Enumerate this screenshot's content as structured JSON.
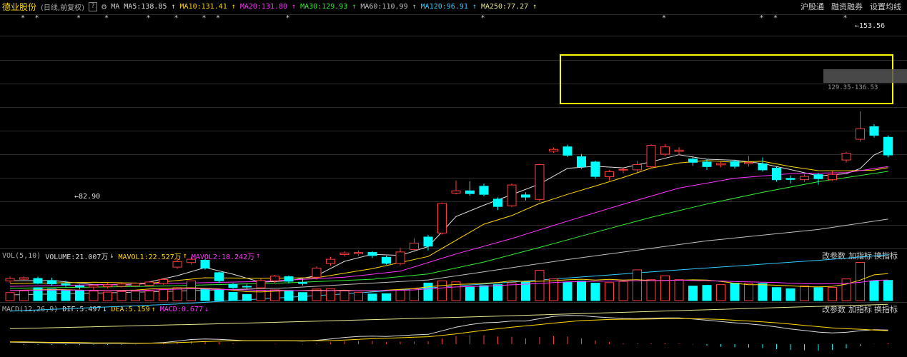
{
  "header": {
    "stock_name": "德业股份",
    "mode": "(日线,前复权)",
    "help": "?",
    "gear_icon": "gear-icon",
    "ma_label": "MA",
    "ma": [
      {
        "label": "MA5:138.85",
        "arrow": "↑",
        "color": "#dddddd"
      },
      {
        "label": "MA10:131.41",
        "arrow": "↑",
        "color": "#ffd700"
      },
      {
        "label": "MA20:131.80",
        "arrow": "↑",
        "color": "#ff33ff"
      },
      {
        "label": "MA30:129.93",
        "arrow": "↑",
        "color": "#33ee33"
      },
      {
        "label": "MA60:110.99",
        "arrow": "↑",
        "color": "#c0c0c0"
      },
      {
        "label": "MA120:96.91",
        "arrow": "↑",
        "color": "#33ccff"
      },
      {
        "label": "MA250:77.27",
        "arrow": "↑",
        "color": "#e8e890"
      }
    ],
    "right_buttons": [
      "沪股通",
      "融资融券",
      "设置均线"
    ]
  },
  "vol_header": {
    "label": "VOL(5,10)",
    "volume": "VOLUME:21.007万",
    "volume_arrow": "↓",
    "mavol1": "MAVOL1:22.527万",
    "mavol1_arrow": "↑",
    "mavol2": "MAVOL2:18.242万",
    "mavol2_arrow": "↑",
    "buttons": [
      "改参数",
      "加指标",
      "换指标"
    ]
  },
  "macd_header": {
    "label": "MACD(12,26,9)",
    "dif": "DIF:5.497",
    "dif_arrow": "↓",
    "dea": "DEA:5.159",
    "dea_arrow": "↑",
    "macd": "MACD:0.677",
    "macd_arrow": "↓",
    "buttons": [
      "改参数",
      "加指标",
      "换指标"
    ]
  },
  "annotations": {
    "high": "153.56",
    "low": "82.90",
    "range_label": "129.35-136.53"
  },
  "colors": {
    "up": "#ff3b3b",
    "down": "#00ffff",
    "box": "#ffff00"
  },
  "chart_data": {
    "type": "candlestick",
    "candles": [
      {
        "o": 86.5,
        "c": 87.5,
        "h": 88.3,
        "l": 85.8
      },
      {
        "o": 87.2,
        "c": 87.8,
        "h": 88.4,
        "l": 86.6
      },
      {
        "o": 87.5,
        "c": 85.6,
        "h": 88.2,
        "l": 85.2
      },
      {
        "o": 86.7,
        "c": 85.4,
        "h": 87.8,
        "l": 84.6
      },
      {
        "o": 85.4,
        "c": 84.9,
        "h": 86.6,
        "l": 84.2
      },
      {
        "o": 84.6,
        "c": 84.1,
        "h": 85.1,
        "l": 83.2
      },
      {
        "o": 84.1,
        "c": 84.8,
        "h": 85.4,
        "l": 83.0
      },
      {
        "o": 84.3,
        "c": 85.0,
        "h": 85.6,
        "l": 83.6
      },
      {
        "o": 84.4,
        "c": 85.3,
        "h": 85.7,
        "l": 83.9
      },
      {
        "o": 84.6,
        "c": 85.6,
        "h": 86.0,
        "l": 84.0
      },
      {
        "o": 84.8,
        "c": 86.1,
        "h": 86.5,
        "l": 84.5
      },
      {
        "o": 85.5,
        "c": 87.1,
        "h": 87.6,
        "l": 85.0
      },
      {
        "o": 92.0,
        "c": 94.2,
        "h": 95.6,
        "l": 91.3
      },
      {
        "o": 93.8,
        "c": 95.1,
        "h": 96.1,
        "l": 93.0
      },
      {
        "o": 94.7,
        "c": 91.6,
        "h": 95.2,
        "l": 91.0
      },
      {
        "o": 89.8,
        "c": 86.6,
        "h": 90.1,
        "l": 85.8
      },
      {
        "o": 85.2,
        "c": 83.9,
        "h": 85.7,
        "l": 83.4
      },
      {
        "o": 84.4,
        "c": 84.1,
        "h": 85.2,
        "l": 83.4
      },
      {
        "o": 83.8,
        "c": 86.7,
        "h": 87.5,
        "l": 83.2
      },
      {
        "o": 86.6,
        "c": 88.4,
        "h": 88.9,
        "l": 85.8
      },
      {
        "o": 88.2,
        "c": 86.4,
        "h": 88.7,
        "l": 85.5
      },
      {
        "o": 86.0,
        "c": 85.5,
        "h": 87.4,
        "l": 84.7
      },
      {
        "o": 88.0,
        "c": 91.6,
        "h": 92.3,
        "l": 87.0
      },
      {
        "o": 93.4,
        "c": 95.1,
        "h": 96.1,
        "l": 92.6
      },
      {
        "o": 97.0,
        "c": 97.6,
        "h": 98.2,
        "l": 96.2
      },
      {
        "o": 97.3,
        "c": 97.8,
        "h": 98.5,
        "l": 96.5
      },
      {
        "o": 97.8,
        "c": 96.6,
        "h": 98.3,
        "l": 95.6
      },
      {
        "o": 95.9,
        "c": 93.5,
        "h": 96.5,
        "l": 93.0
      },
      {
        "o": 93.4,
        "c": 98.0,
        "h": 99.6,
        "l": 92.7
      },
      {
        "o": 99.0,
        "c": 101.5,
        "h": 103.4,
        "l": 98.0
      },
      {
        "o": 103.9,
        "c": 100.3,
        "h": 104.8,
        "l": 98.6
      },
      {
        "o": 105.5,
        "c": 117.2,
        "h": 117.5,
        "l": 104.9
      },
      {
        "o": 121.3,
        "c": 122.2,
        "h": 126.3,
        "l": 120.8
      },
      {
        "o": 122.2,
        "c": 121.1,
        "h": 125.9,
        "l": 120.3
      },
      {
        "o": 124.0,
        "c": 120.8,
        "h": 125.1,
        "l": 120.0
      },
      {
        "o": 118.9,
        "c": 116.0,
        "h": 119.6,
        "l": 114.6
      },
      {
        "o": 116.3,
        "c": 124.5,
        "h": 125.1,
        "l": 115.7
      },
      {
        "o": 120.6,
        "c": 119.7,
        "h": 121.6,
        "l": 118.4
      },
      {
        "o": 118.8,
        "c": 132.6,
        "h": 132.9,
        "l": 118.0
      },
      {
        "o": 137.9,
        "c": 138.6,
        "h": 139.3,
        "l": 137.3
      },
      {
        "o": 139.6,
        "c": 136.3,
        "h": 140.5,
        "l": 135.6
      },
      {
        "o": 135.7,
        "c": 131.7,
        "h": 136.8,
        "l": 130.9
      },
      {
        "o": 133.6,
        "c": 127.9,
        "h": 134.1,
        "l": 127.0
      },
      {
        "o": 127.8,
        "c": 129.8,
        "h": 130.4,
        "l": 126.3
      },
      {
        "o": 130.4,
        "c": 130.7,
        "h": 131.2,
        "l": 129.2
      },
      {
        "o": 130.5,
        "c": 132.6,
        "h": 134.1,
        "l": 129.5
      },
      {
        "o": 131.7,
        "c": 140.2,
        "h": 140.6,
        "l": 131.2
      },
      {
        "o": 136.7,
        "c": 139.6,
        "h": 140.6,
        "l": 136.0
      },
      {
        "o": 137.8,
        "c": 138.3,
        "h": 139.5,
        "l": 136.3
      },
      {
        "o": 134.8,
        "c": 133.5,
        "h": 135.9,
        "l": 132.1
      },
      {
        "o": 133.6,
        "c": 131.8,
        "h": 134.8,
        "l": 130.5
      },
      {
        "o": 132.5,
        "c": 133.0,
        "h": 133.7,
        "l": 131.5
      },
      {
        "o": 133.8,
        "c": 131.9,
        "h": 134.5,
        "l": 131.0
      },
      {
        "o": 132.9,
        "c": 133.4,
        "h": 136.0,
        "l": 131.8
      },
      {
        "o": 132.9,
        "c": 130.5,
        "h": 135.4,
        "l": 129.8
      },
      {
        "o": 131.2,
        "c": 126.6,
        "h": 131.7,
        "l": 125.8
      },
      {
        "o": 127.1,
        "c": 126.7,
        "h": 128.3,
        "l": 125.1
      },
      {
        "o": 126.6,
        "c": 127.9,
        "h": 128.7,
        "l": 125.7
      },
      {
        "o": 128.6,
        "c": 127.0,
        "h": 129.3,
        "l": 124.6
      },
      {
        "o": 126.6,
        "c": 128.7,
        "h": 130.0,
        "l": 126.1
      },
      {
        "o": 134.4,
        "c": 137.1,
        "h": 137.6,
        "l": 133.4
      },
      {
        "o": 142.6,
        "c": 146.8,
        "h": 153.6,
        "l": 141.7
      },
      {
        "o": 147.6,
        "c": 144.2,
        "h": 148.6,
        "l": 143.3
      },
      {
        "o": 143.4,
        "c": 136.4,
        "h": 144.1,
        "l": 135.5
      }
    ],
    "ma_lines": [
      {
        "name": "MA5",
        "color": "#dddddd",
        "pts": [
          [
            0,
            86.6
          ],
          [
            3,
            86.7
          ],
          [
            6,
            85.1
          ],
          [
            9,
            84.9
          ],
          [
            12,
            88.6
          ],
          [
            14,
            91.8
          ],
          [
            16,
            89.2
          ],
          [
            18,
            86.0
          ],
          [
            20,
            86.6
          ],
          [
            22,
            88.6
          ],
          [
            24,
            94.3
          ],
          [
            26,
            97.1
          ],
          [
            28,
            96.6
          ],
          [
            30,
            100.1
          ],
          [
            31,
            106.0
          ],
          [
            32,
            112.0
          ],
          [
            34,
            116.5
          ],
          [
            36,
            120.7
          ],
          [
            38,
            124.9
          ],
          [
            40,
            131.1
          ],
          [
            42,
            131.9
          ],
          [
            44,
            131.3
          ],
          [
            46,
            133.7
          ],
          [
            48,
            136.5
          ],
          [
            50,
            134.7
          ],
          [
            52,
            134.3
          ],
          [
            54,
            133.0
          ],
          [
            56,
            130.6
          ],
          [
            58,
            128.1
          ],
          [
            60,
            129.0
          ],
          [
            61,
            131.0
          ],
          [
            62,
            136.4
          ],
          [
            63,
            138.9
          ]
        ]
      },
      {
        "name": "MA10",
        "color": "#ffd700",
        "pts": [
          [
            0,
            85.5
          ],
          [
            6,
            86.0
          ],
          [
            10,
            85.6
          ],
          [
            14,
            87.8
          ],
          [
            18,
            87.6
          ],
          [
            22,
            87.8
          ],
          [
            26,
            91.4
          ],
          [
            30,
            96.2
          ],
          [
            32,
            102.6
          ],
          [
            34,
            109.0
          ],
          [
            36,
            112.4
          ],
          [
            38,
            117.2
          ],
          [
            40,
            120.8
          ],
          [
            42,
            124.1
          ],
          [
            44,
            127.5
          ],
          [
            46,
            131.2
          ],
          [
            48,
            133.2
          ],
          [
            50,
            134.2
          ],
          [
            52,
            133.5
          ],
          [
            54,
            133.9
          ],
          [
            56,
            131.8
          ],
          [
            58,
            130.2
          ],
          [
            60,
            130.1
          ],
          [
            62,
            130.4
          ],
          [
            63,
            131.4
          ]
        ]
      },
      {
        "name": "MA20",
        "color": "#ff33ff",
        "pts": [
          [
            0,
            84.4
          ],
          [
            10,
            85.4
          ],
          [
            18,
            86.3
          ],
          [
            24,
            88.0
          ],
          [
            28,
            90.4
          ],
          [
            32,
            97.2
          ],
          [
            36,
            103.3
          ],
          [
            40,
            110.2
          ],
          [
            44,
            116.9
          ],
          [
            48,
            123.3
          ],
          [
            52,
            127.2
          ],
          [
            56,
            129.0
          ],
          [
            60,
            129.4
          ],
          [
            63,
            131.8
          ]
        ]
      },
      {
        "name": "MA30",
        "color": "#33ee33",
        "pts": [
          [
            0,
            83.6
          ],
          [
            10,
            84.4
          ],
          [
            20,
            85.8
          ],
          [
            26,
            87.2
          ],
          [
            30,
            89.3
          ],
          [
            34,
            94.0
          ],
          [
            38,
            99.8
          ],
          [
            42,
            105.8
          ],
          [
            46,
            111.7
          ],
          [
            50,
            117.0
          ],
          [
            54,
            121.6
          ],
          [
            58,
            125.8
          ],
          [
            63,
            129.9
          ]
        ]
      },
      {
        "name": "MA60",
        "color": "#c0c0c0",
        "pts": [
          [
            0,
            81.0
          ],
          [
            10,
            82.2
          ],
          [
            20,
            83.8
          ],
          [
            30,
            86.9
          ],
          [
            40,
            95.0
          ],
          [
            50,
            102.4
          ],
          [
            58,
            106.9
          ],
          [
            63,
            110.99
          ]
        ]
      },
      {
        "name": "MA120",
        "color": "#33ccff",
        "pts": [
          [
            0,
            74.6
          ],
          [
            12,
            77.4
          ],
          [
            24,
            81.4
          ],
          [
            36,
            86.1
          ],
          [
            48,
            90.9
          ],
          [
            58,
            94.7
          ],
          [
            63,
            96.91
          ]
        ]
      },
      {
        "name": "MA250",
        "color": "#e8e890",
        "pts": [
          [
            0,
            67.6
          ],
          [
            16,
            69.7
          ],
          [
            32,
            72.1
          ],
          [
            48,
            74.8
          ],
          [
            63,
            77.27
          ]
        ]
      }
    ],
    "volume": [
      5.5,
      6.7,
      8.8,
      7.9,
      7.3,
      6.9,
      6.5,
      5.8,
      6.2,
      6.4,
      6.5,
      7.6,
      8.8,
      13.5,
      8.2,
      7.2,
      5.6,
      4.2,
      6.9,
      7.3,
      6.9,
      5.5,
      7.9,
      8.0,
      6.7,
      5.7,
      4.5,
      4.7,
      7.1,
      8.0,
      12.0,
      13.5,
      12.8,
      9.2,
      10.2,
      10.9,
      12.2,
      12.6,
      20.7,
      14.8,
      12.4,
      13.3,
      11.9,
      12.3,
      13.1,
      21.0,
      14.3,
      17.0,
      14.3,
      9.9,
      10.4,
      10.9,
      11.9,
      11.8,
      11.7,
      8.9,
      8.1,
      10.0,
      8.9,
      9.0,
      14.8,
      26.1,
      13.5,
      13.8
    ],
    "mavol1": [
      6.8,
      7.1,
      7.3,
      7.6,
      7.4,
      7.1,
      7.0,
      6.9,
      7.0,
      7.2,
      7.9,
      8.3,
      8.6,
      8.8,
      8.4,
      8.0,
      7.1,
      6.1,
      5.9,
      6.4,
      6.8,
      6.9,
      7.1,
      6.9,
      7.1,
      6.8,
      6.5,
      7.1,
      7.7,
      8.3,
      9.4,
      10.3,
      11.0,
      11.3,
      11.8,
      12.4,
      13.5,
      13.0,
      13.2,
      13.6,
      14.2,
      14.6,
      14.0,
      14.5,
      14.0,
      14.3,
      13.7,
      13.8,
      13.9,
      14.2,
      14.0,
      13.1,
      11.8,
      10.9,
      10.9,
      10.5,
      10.1,
      9.5,
      9.4,
      9.7,
      11.2,
      14.0,
      17.6,
      18.4
    ],
    "mavol2": [
      6.9,
      7.0,
      7.1,
      7.3,
      7.2,
      7.1,
      7.0,
      6.9,
      6.8,
      6.9,
      7.1,
      7.5,
      7.8,
      8.1,
      7.9,
      7.7,
      7.4,
      7.3,
      7.0,
      7.0,
      6.9,
      6.8,
      6.8,
      6.8,
      6.8,
      6.8,
      6.8,
      6.9,
      7.0,
      7.3,
      8.0,
      8.7,
      9.3,
      9.6,
      9.8,
      10.3,
      10.8,
      11.2,
      11.7,
      12.3,
      12.8,
      13.0,
      13.2,
      13.3,
      13.4,
      13.5,
      13.6,
      13.8,
      14.0,
      13.7,
      13.6,
      13.4,
      13.0,
      12.8,
      12.6,
      12.4,
      11.8,
      11.5,
      11.4,
      11.5,
      11.7,
      12.5,
      13.8,
      14.1
    ],
    "dif": [
      0.8,
      0.7,
      0.6,
      0.5,
      0.4,
      0.3,
      0.3,
      0.3,
      0.3,
      0.3,
      0.4,
      0.6,
      1.2,
      1.8,
      2.0,
      1.9,
      1.6,
      1.3,
      1.3,
      1.4,
      1.3,
      1.2,
      1.5,
      2.0,
      2.6,
      3.0,
      3.1,
      3.0,
      3.3,
      3.6,
      3.8,
      5.2,
      6.6,
      7.6,
      8.3,
      8.5,
      9.0,
      9.0,
      9.9,
      10.8,
      11.2,
      11.1,
      10.6,
      10.3,
      10.0,
      9.9,
      10.1,
      10.2,
      10.2,
      9.8,
      9.3,
      8.8,
      8.3,
      7.9,
      7.4,
      6.7,
      5.9,
      5.3,
      4.7,
      4.4,
      4.6,
      5.2,
      5.6,
      5.5
    ],
    "dea": [
      0.9,
      0.9,
      0.8,
      0.7,
      0.7,
      0.6,
      0.5,
      0.5,
      0.5,
      0.4,
      0.4,
      0.4,
      0.6,
      0.8,
      1.0,
      1.2,
      1.3,
      1.3,
      1.3,
      1.3,
      1.3,
      1.3,
      1.3,
      1.4,
      1.6,
      1.9,
      2.1,
      2.3,
      2.5,
      2.7,
      2.9,
      3.4,
      4.0,
      4.7,
      5.4,
      6.0,
      6.6,
      7.1,
      7.6,
      8.2,
      8.7,
      9.2,
      9.4,
      9.6,
      9.7,
      9.7,
      9.8,
      9.9,
      10.0,
      9.9,
      9.8,
      9.6,
      9.3,
      9.0,
      8.7,
      8.3,
      7.8,
      7.3,
      6.8,
      6.3,
      6.0,
      5.8,
      5.5,
      5.2
    ]
  }
}
